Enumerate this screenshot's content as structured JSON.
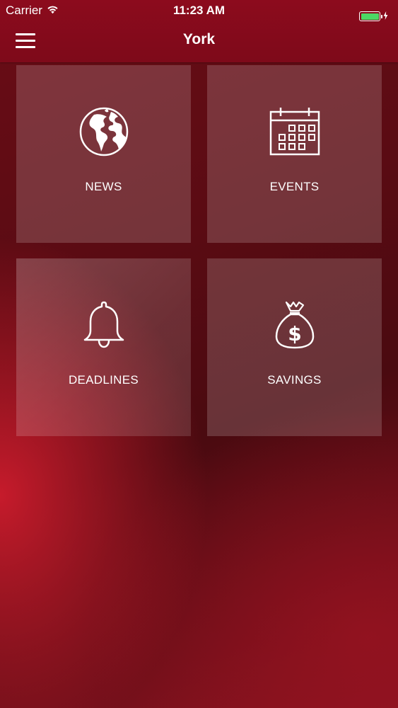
{
  "status_bar": {
    "carrier": "Carrier",
    "time": "11:23 AM",
    "battery_level_percent": 100,
    "battery_color": "#4cd964"
  },
  "nav_bar": {
    "title": "York",
    "menu_icon": "hamburger-menu-icon",
    "background_color": "#8c0b1d"
  },
  "tiles": [
    {
      "label": "NEWS",
      "icon": "globe-icon"
    },
    {
      "label": "EVENTS",
      "icon": "calendar-icon"
    },
    {
      "label": "DEADLINES",
      "icon": "bell-icon"
    },
    {
      "label": "SAVINGS",
      "icon": "money-bag-icon"
    }
  ]
}
